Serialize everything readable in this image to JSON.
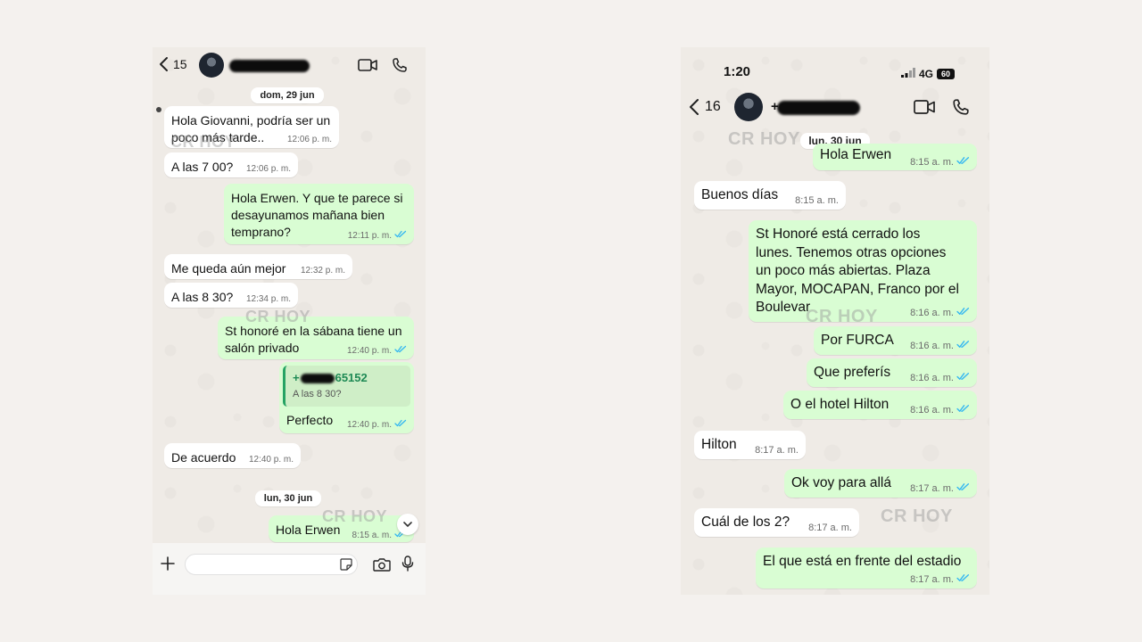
{
  "left_chat": {
    "header": {
      "back_count": "15",
      "icons": [
        "chevron-left-icon",
        "video-call-icon",
        "phone-icon"
      ]
    },
    "dates": {
      "first": "dom, 29 jun",
      "second": "lun, 30 jun"
    },
    "watermark": "CR HOY",
    "messages": [
      {
        "dir": "in",
        "text": "Hola Giovanni, podría ser un\npoco más tarde..",
        "time": "12:06 p. m."
      },
      {
        "dir": "in",
        "text": "A las 7 00?",
        "time": "12:06 p. m."
      },
      {
        "dir": "out",
        "text": "Hola Erwen. Y que te parece si\ndesayunamos mañana bien\ntemprano?",
        "time": "12:11 p. m."
      },
      {
        "dir": "in",
        "text": "Me queda aún mejor",
        "time": "12:32 p. m."
      },
      {
        "dir": "in",
        "text": "A las 8 30?",
        "time": "12:34 p. m."
      },
      {
        "dir": "out",
        "text": "St honoré en la sábana tiene un\nsalón privado",
        "time": "12:40 p. m."
      },
      {
        "dir": "out",
        "text": "Perfecto",
        "time": "12:40 p. m.",
        "quote": {
          "number": "+",
          "number_suffix": "65152",
          "text": "A las 8 30?"
        }
      },
      {
        "dir": "in",
        "text": "De acuerdo",
        "time": "12:40 p. m."
      },
      {
        "dir": "out",
        "text": "Hola Erwen",
        "time": "8:15 a. m."
      }
    ],
    "input": {
      "icons": [
        "plus-icon",
        "sticker-icon",
        "camera-icon",
        "microphone-icon"
      ]
    }
  },
  "right_chat": {
    "status": {
      "time": "1:20",
      "network": "4G",
      "battery": "60"
    },
    "header": {
      "back_count": "16",
      "contact_prefix": "+",
      "icons": [
        "chevron-left-icon",
        "video-call-icon",
        "phone-icon"
      ]
    },
    "dates": {
      "first": "lun, 30 jun"
    },
    "watermark": "CR HOY",
    "messages": [
      {
        "dir": "out",
        "text": "Hola Erwen",
        "time": "8:15 a. m."
      },
      {
        "dir": "in",
        "text": "Buenos días",
        "time": "8:15 a. m."
      },
      {
        "dir": "out",
        "text": "St Honoré está cerrado los\nlunes. Tenemos otras opciones\nun poco más abiertas. Plaza\nMayor, MOCAPAN, Franco por el\nBoulevar",
        "time": "8:16 a. m."
      },
      {
        "dir": "out",
        "text": "Por FURCA",
        "time": "8:16 a. m."
      },
      {
        "dir": "out",
        "text": "Que preferís",
        "time": "8:16 a. m."
      },
      {
        "dir": "out",
        "text": "O el hotel Hilton",
        "time": "8:16 a. m."
      },
      {
        "dir": "in",
        "text": "Hilton",
        "time": "8:17 a. m."
      },
      {
        "dir": "out",
        "text": "Ok voy para allá",
        "time": "8:17 a. m."
      },
      {
        "dir": "in",
        "text": "Cuál de los 2?",
        "time": "8:17 a. m."
      },
      {
        "dir": "out",
        "text": "El que está en frente del estadio",
        "time": "8:17 a. m."
      }
    ]
  },
  "colors": {
    "incoming": "#ffffff",
    "outgoing": "#d9fdd3",
    "read_ticks": "#34b7f1",
    "quote_accent": "#25a363"
  }
}
